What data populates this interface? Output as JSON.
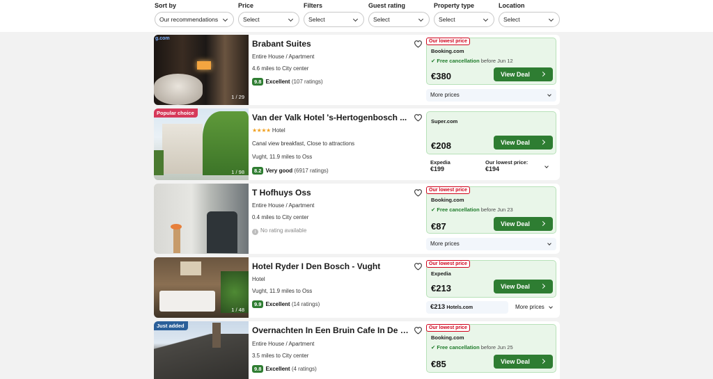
{
  "filters": [
    {
      "label": "Sort by",
      "value": "Our recommendations"
    },
    {
      "label": "Price",
      "value": "Select"
    },
    {
      "label": "Filters",
      "value": "Select"
    },
    {
      "label": "Guest rating",
      "value": "Select"
    },
    {
      "label": "Property type",
      "value": "Select"
    },
    {
      "label": "Location",
      "value": "Select"
    }
  ],
  "results": [
    {
      "name": "Brabant Suites",
      "type": "Entire House / Apartment",
      "distance": "4.6 miles to City center",
      "rating": {
        "score": "9.8",
        "word": "Excellent",
        "count": "(107 ratings)"
      },
      "photo_count": "1 / 29",
      "photo_watermark": "g.com",
      "deal": {
        "lowest_tag": "Our lowest price",
        "provider": "Booking.com",
        "cancel": "Free cancellation",
        "cancel_before": "before Jun 12",
        "price": "€380",
        "button": "View Deal"
      },
      "more_prices": "More prices"
    },
    {
      "name": "Van der Valk Hotel 's-Hertogenbosch ...",
      "tag": "Popular choice",
      "stars": "★★★★",
      "type": "Hotel",
      "amenities": "Canal view breakfast, Close to attractions",
      "distance": "Vught, 11.9 miles to Oss",
      "rating": {
        "score": "8.2",
        "word": "Very good",
        "count": "(6917 ratings)"
      },
      "photo_count": "1 / 98",
      "deal": {
        "provider": "Super.com",
        "price": "€208",
        "button": "View Deal"
      },
      "alt_left": {
        "provider": "Expedia",
        "price": "€199"
      },
      "alt_right": {
        "label": "Our lowest price:",
        "price": "€194"
      }
    },
    {
      "name": "T Hofhuys Oss",
      "type": "Entire House / Apartment",
      "distance": "0.4 miles to City center",
      "no_rating": "No rating available",
      "deal": {
        "lowest_tag": "Our lowest price",
        "provider": "Booking.com",
        "cancel": "Free cancellation",
        "cancel_before": "before Jun 23",
        "price": "€87",
        "button": "View Deal"
      },
      "more_prices": "More prices"
    },
    {
      "name": "Hotel Ryder I Den Bosch - Vught",
      "type": "Hotel",
      "distance": "Vught, 11.9 miles to Oss",
      "rating": {
        "score": "9.9",
        "word": "Excellent",
        "count": "(14 ratings)"
      },
      "photo_count": "1 / 48",
      "deal": {
        "lowest_tag": "Our lowest price",
        "provider": "Expedia",
        "price": "€213",
        "button": "View Deal"
      },
      "alt_price": "€213",
      "alt_provider": "Hotels.com",
      "more_prices": "More prices"
    },
    {
      "name": "Overnachten In Een Bruin Cafe In De P...",
      "tag": "Just added",
      "type": "Entire House / Apartment",
      "distance": "3.5 miles to City center",
      "rating": {
        "score": "9.8",
        "word": "Excellent",
        "count": "(4 ratings)"
      },
      "deal": {
        "lowest_tag": "Our lowest price",
        "provider": "Booking.com",
        "cancel": "Free cancellation",
        "cancel_before": "before Jun 25",
        "price": "€85",
        "button": "View Deal"
      }
    }
  ]
}
